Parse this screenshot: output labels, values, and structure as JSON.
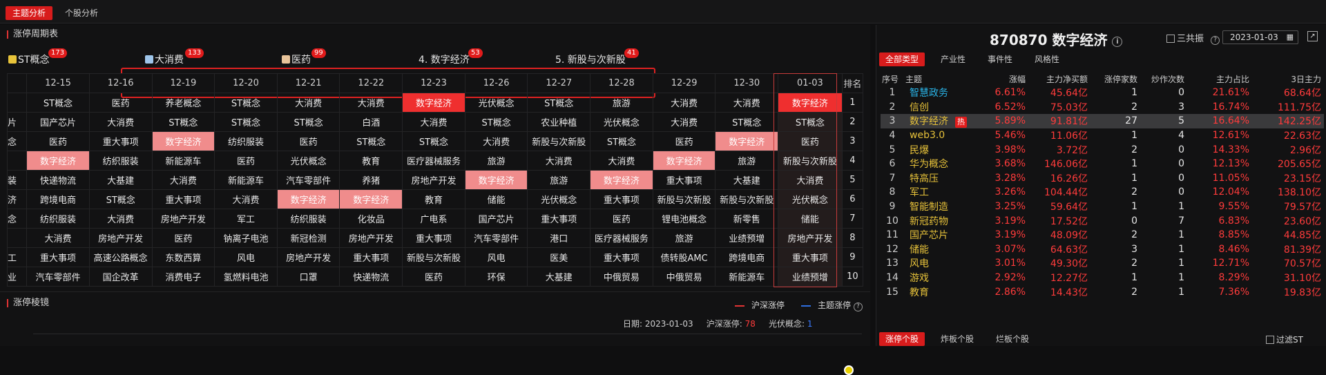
{
  "top_tabs": [
    "主题分析",
    "个股分析"
  ],
  "cycle_title": "涨停周期表",
  "themes": [
    {
      "label": "ST概念",
      "badge": "173",
      "color": "#e8c43a"
    },
    {
      "label": "大消费",
      "badge": "133",
      "color": "#9ec5ea"
    },
    {
      "label": "医药",
      "badge": "99",
      "color": "#e8c49a"
    },
    {
      "label": "4. 数字经济",
      "badge": "53",
      "color": ""
    },
    {
      "label": "5. 新股与次新股",
      "badge": "41",
      "color": ""
    }
  ],
  "grid": {
    "dates": [
      "12-15",
      "12-16",
      "12-19",
      "12-20",
      "12-21",
      "12-22",
      "12-23",
      "12-26",
      "12-27",
      "12-28",
      "12-29",
      "12-30",
      "01-03"
    ],
    "rank_header": "排名",
    "left_fragments": [
      "",
      "片",
      "念",
      "",
      "装",
      "济",
      "念",
      "",
      "工",
      "业"
    ],
    "rows": [
      [
        "ST概念",
        "医药",
        "养老概念",
        "ST概念",
        "大消费",
        "大消费",
        "数字经济",
        "光伏概念",
        "ST概念",
        "旅游",
        "大消费",
        "大消费",
        "数字经济"
      ],
      [
        "国产芯片",
        "大消费",
        "ST概念",
        "ST概念",
        "ST概念",
        "白酒",
        "大消费",
        "ST概念",
        "农业种植",
        "光伏概念",
        "大消费",
        "ST概念",
        "ST概念"
      ],
      [
        "医药",
        "重大事项",
        "数字经济",
        "纺织服装",
        "医药",
        "ST概念",
        "ST概念",
        "大消费",
        "新股与次新股",
        "ST概念",
        "医药",
        "数字经济",
        "医药"
      ],
      [
        "数字经济",
        "纺织服装",
        "新能源车",
        "医药",
        "光伏概念",
        "教育",
        "医疗器械服务",
        "旅游",
        "大消费",
        "大消费",
        "数字经济",
        "旅游",
        "新股与次新股"
      ],
      [
        "快递物流",
        "大基建",
        "大消费",
        "新能源车",
        "汽车零部件",
        "养猪",
        "房地产开发",
        "数字经济",
        "旅游",
        "数字经济",
        "重大事项",
        "大基建",
        "大消费"
      ],
      [
        "跨境电商",
        "ST概念",
        "重大事项",
        "大消费",
        "数字经济",
        "数字经济",
        "教育",
        "储能",
        "光伏概念",
        "重大事项",
        "新股与次新股",
        "新股与次新股",
        "光伏概念"
      ],
      [
        "纺织服装",
        "大消费",
        "房地产开发",
        "军工",
        "纺织服装",
        "化妆品",
        "广电系",
        "国产芯片",
        "重大事项",
        "医药",
        "锂电池概念",
        "新零售",
        "储能"
      ],
      [
        "大消费",
        "房地产开发",
        "医药",
        "钠离子电池",
        "新冠检测",
        "房地产开发",
        "重大事项",
        "汽车零部件",
        "港口",
        "医疗器械服务",
        "旅游",
        "业绩预增",
        "房地产开发"
      ],
      [
        "重大事项",
        "高速公路概念",
        "东数西算",
        "风电",
        "房地产开发",
        "重大事项",
        "新股与次新股",
        "风电",
        "医美",
        "重大事项",
        "债转股AMC",
        "跨境电商",
        "重大事项"
      ],
      [
        "汽车零部件",
        "国企改革",
        "消费电子",
        "氢燃料电池",
        "口罩",
        "快递物流",
        "医药",
        "环保",
        "大基建",
        "中俄贸易",
        "中俄贸易",
        "新能源车",
        "业绩预增"
      ]
    ],
    "ranks": [
      "1",
      "2",
      "3",
      "4",
      "5",
      "6",
      "7",
      "8",
      "9",
      "10"
    ]
  },
  "lower": {
    "title": "涨停棱镜",
    "legend_a": "沪深涨停",
    "legend_b": "主题涨停",
    "info_date_label": "日期:",
    "info_date": "2023-01-03",
    "info_a_label": "沪深涨停:",
    "info_a_value": "78",
    "info_b_label": "光伏概念:",
    "info_b_value": "1"
  },
  "right": {
    "title": "870870 数字经济",
    "chk_label": "三共振",
    "date": "2023-01-03",
    "tabs": [
      "全部类型",
      "产业性",
      "事件性",
      "风格性"
    ],
    "headers": [
      "序号",
      "主题",
      "涨幅",
      "主力净买额",
      "涨停家数",
      "炒作次数",
      "主力占比",
      "3日主力"
    ],
    "hot_label": "热",
    "rows": [
      [
        "1",
        "智慧政务",
        "6.61%",
        "45.64亿",
        "1",
        "0",
        "21.61%",
        "68.64亿"
      ],
      [
        "2",
        "信创",
        "6.52%",
        "75.03亿",
        "2",
        "3",
        "16.74%",
        "111.75亿"
      ],
      [
        "3",
        "数字经济",
        "5.89%",
        "91.81亿",
        "27",
        "5",
        "16.64%",
        "142.25亿"
      ],
      [
        "4",
        "web3.0",
        "5.46%",
        "11.06亿",
        "1",
        "4",
        "12.61%",
        "22.63亿"
      ],
      [
        "5",
        "民爆",
        "3.98%",
        "3.72亿",
        "2",
        "0",
        "14.33%",
        "2.96亿"
      ],
      [
        "6",
        "华为概念",
        "3.68%",
        "146.06亿",
        "1",
        "0",
        "12.13%",
        "205.65亿"
      ],
      [
        "7",
        "特高压",
        "3.28%",
        "16.26亿",
        "1",
        "0",
        "11.05%",
        "23.15亿"
      ],
      [
        "8",
        "军工",
        "3.26%",
        "104.44亿",
        "2",
        "0",
        "12.04%",
        "138.10亿"
      ],
      [
        "9",
        "智能制造",
        "3.25%",
        "59.64亿",
        "1",
        "1",
        "9.55%",
        "79.57亿"
      ],
      [
        "10",
        "新冠药物",
        "3.19%",
        "17.52亿",
        "0",
        "7",
        "6.83%",
        "23.60亿"
      ],
      [
        "11",
        "国产芯片",
        "3.19%",
        "48.09亿",
        "2",
        "1",
        "8.85%",
        "44.85亿"
      ],
      [
        "12",
        "储能",
        "3.07%",
        "64.63亿",
        "3",
        "1",
        "8.46%",
        "81.39亿"
      ],
      [
        "13",
        "风电",
        "3.01%",
        "49.30亿",
        "2",
        "1",
        "12.71%",
        "70.57亿"
      ],
      [
        "14",
        "游戏",
        "2.92%",
        "12.27亿",
        "1",
        "1",
        "8.29%",
        "31.10亿"
      ],
      [
        "15",
        "教育",
        "2.86%",
        "14.43亿",
        "2",
        "1",
        "7.36%",
        "19.83亿"
      ]
    ],
    "bottom_tabs": [
      "涨停个股",
      "炸板个股",
      "烂板个股"
    ],
    "filter_label": "过滤ST"
  }
}
